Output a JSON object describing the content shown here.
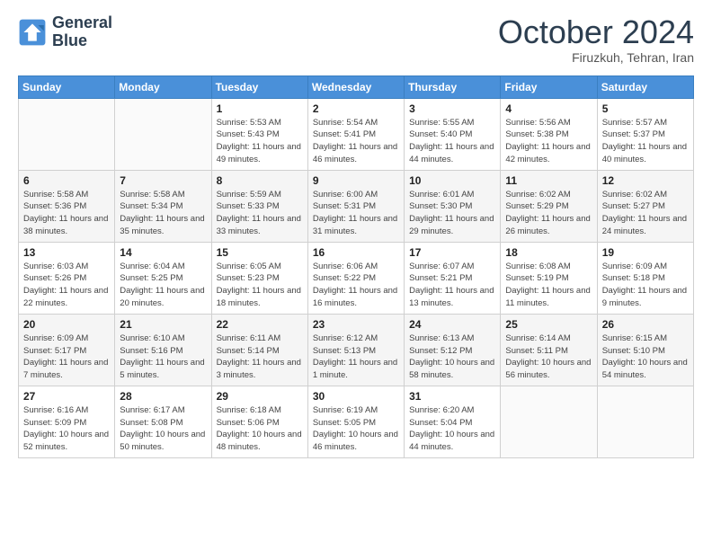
{
  "logo": {
    "line1": "General",
    "line2": "Blue"
  },
  "title": "October 2024",
  "subtitle": "Firuzkuh, Tehran, Iran",
  "header_days": [
    "Sunday",
    "Monday",
    "Tuesday",
    "Wednesday",
    "Thursday",
    "Friday",
    "Saturday"
  ],
  "weeks": [
    [
      {
        "day": "",
        "sunrise": "",
        "sunset": "",
        "daylight": ""
      },
      {
        "day": "",
        "sunrise": "",
        "sunset": "",
        "daylight": ""
      },
      {
        "day": "1",
        "sunrise": "Sunrise: 5:53 AM",
        "sunset": "Sunset: 5:43 PM",
        "daylight": "Daylight: 11 hours and 49 minutes."
      },
      {
        "day": "2",
        "sunrise": "Sunrise: 5:54 AM",
        "sunset": "Sunset: 5:41 PM",
        "daylight": "Daylight: 11 hours and 46 minutes."
      },
      {
        "day": "3",
        "sunrise": "Sunrise: 5:55 AM",
        "sunset": "Sunset: 5:40 PM",
        "daylight": "Daylight: 11 hours and 44 minutes."
      },
      {
        "day": "4",
        "sunrise": "Sunrise: 5:56 AM",
        "sunset": "Sunset: 5:38 PM",
        "daylight": "Daylight: 11 hours and 42 minutes."
      },
      {
        "day": "5",
        "sunrise": "Sunrise: 5:57 AM",
        "sunset": "Sunset: 5:37 PM",
        "daylight": "Daylight: 11 hours and 40 minutes."
      }
    ],
    [
      {
        "day": "6",
        "sunrise": "Sunrise: 5:58 AM",
        "sunset": "Sunset: 5:36 PM",
        "daylight": "Daylight: 11 hours and 38 minutes."
      },
      {
        "day": "7",
        "sunrise": "Sunrise: 5:58 AM",
        "sunset": "Sunset: 5:34 PM",
        "daylight": "Daylight: 11 hours and 35 minutes."
      },
      {
        "day": "8",
        "sunrise": "Sunrise: 5:59 AM",
        "sunset": "Sunset: 5:33 PM",
        "daylight": "Daylight: 11 hours and 33 minutes."
      },
      {
        "day": "9",
        "sunrise": "Sunrise: 6:00 AM",
        "sunset": "Sunset: 5:31 PM",
        "daylight": "Daylight: 11 hours and 31 minutes."
      },
      {
        "day": "10",
        "sunrise": "Sunrise: 6:01 AM",
        "sunset": "Sunset: 5:30 PM",
        "daylight": "Daylight: 11 hours and 29 minutes."
      },
      {
        "day": "11",
        "sunrise": "Sunrise: 6:02 AM",
        "sunset": "Sunset: 5:29 PM",
        "daylight": "Daylight: 11 hours and 26 minutes."
      },
      {
        "day": "12",
        "sunrise": "Sunrise: 6:02 AM",
        "sunset": "Sunset: 5:27 PM",
        "daylight": "Daylight: 11 hours and 24 minutes."
      }
    ],
    [
      {
        "day": "13",
        "sunrise": "Sunrise: 6:03 AM",
        "sunset": "Sunset: 5:26 PM",
        "daylight": "Daylight: 11 hours and 22 minutes."
      },
      {
        "day": "14",
        "sunrise": "Sunrise: 6:04 AM",
        "sunset": "Sunset: 5:25 PM",
        "daylight": "Daylight: 11 hours and 20 minutes."
      },
      {
        "day": "15",
        "sunrise": "Sunrise: 6:05 AM",
        "sunset": "Sunset: 5:23 PM",
        "daylight": "Daylight: 11 hours and 18 minutes."
      },
      {
        "day": "16",
        "sunrise": "Sunrise: 6:06 AM",
        "sunset": "Sunset: 5:22 PM",
        "daylight": "Daylight: 11 hours and 16 minutes."
      },
      {
        "day": "17",
        "sunrise": "Sunrise: 6:07 AM",
        "sunset": "Sunset: 5:21 PM",
        "daylight": "Daylight: 11 hours and 13 minutes."
      },
      {
        "day": "18",
        "sunrise": "Sunrise: 6:08 AM",
        "sunset": "Sunset: 5:19 PM",
        "daylight": "Daylight: 11 hours and 11 minutes."
      },
      {
        "day": "19",
        "sunrise": "Sunrise: 6:09 AM",
        "sunset": "Sunset: 5:18 PM",
        "daylight": "Daylight: 11 hours and 9 minutes."
      }
    ],
    [
      {
        "day": "20",
        "sunrise": "Sunrise: 6:09 AM",
        "sunset": "Sunset: 5:17 PM",
        "daylight": "Daylight: 11 hours and 7 minutes."
      },
      {
        "day": "21",
        "sunrise": "Sunrise: 6:10 AM",
        "sunset": "Sunset: 5:16 PM",
        "daylight": "Daylight: 11 hours and 5 minutes."
      },
      {
        "day": "22",
        "sunrise": "Sunrise: 6:11 AM",
        "sunset": "Sunset: 5:14 PM",
        "daylight": "Daylight: 11 hours and 3 minutes."
      },
      {
        "day": "23",
        "sunrise": "Sunrise: 6:12 AM",
        "sunset": "Sunset: 5:13 PM",
        "daylight": "Daylight: 11 hours and 1 minute."
      },
      {
        "day": "24",
        "sunrise": "Sunrise: 6:13 AM",
        "sunset": "Sunset: 5:12 PM",
        "daylight": "Daylight: 10 hours and 58 minutes."
      },
      {
        "day": "25",
        "sunrise": "Sunrise: 6:14 AM",
        "sunset": "Sunset: 5:11 PM",
        "daylight": "Daylight: 10 hours and 56 minutes."
      },
      {
        "day": "26",
        "sunrise": "Sunrise: 6:15 AM",
        "sunset": "Sunset: 5:10 PM",
        "daylight": "Daylight: 10 hours and 54 minutes."
      }
    ],
    [
      {
        "day": "27",
        "sunrise": "Sunrise: 6:16 AM",
        "sunset": "Sunset: 5:09 PM",
        "daylight": "Daylight: 10 hours and 52 minutes."
      },
      {
        "day": "28",
        "sunrise": "Sunrise: 6:17 AM",
        "sunset": "Sunset: 5:08 PM",
        "daylight": "Daylight: 10 hours and 50 minutes."
      },
      {
        "day": "29",
        "sunrise": "Sunrise: 6:18 AM",
        "sunset": "Sunset: 5:06 PM",
        "daylight": "Daylight: 10 hours and 48 minutes."
      },
      {
        "day": "30",
        "sunrise": "Sunrise: 6:19 AM",
        "sunset": "Sunset: 5:05 PM",
        "daylight": "Daylight: 10 hours and 46 minutes."
      },
      {
        "day": "31",
        "sunrise": "Sunrise: 6:20 AM",
        "sunset": "Sunset: 5:04 PM",
        "daylight": "Daylight: 10 hours and 44 minutes."
      },
      {
        "day": "",
        "sunrise": "",
        "sunset": "",
        "daylight": ""
      },
      {
        "day": "",
        "sunrise": "",
        "sunset": "",
        "daylight": ""
      }
    ]
  ]
}
